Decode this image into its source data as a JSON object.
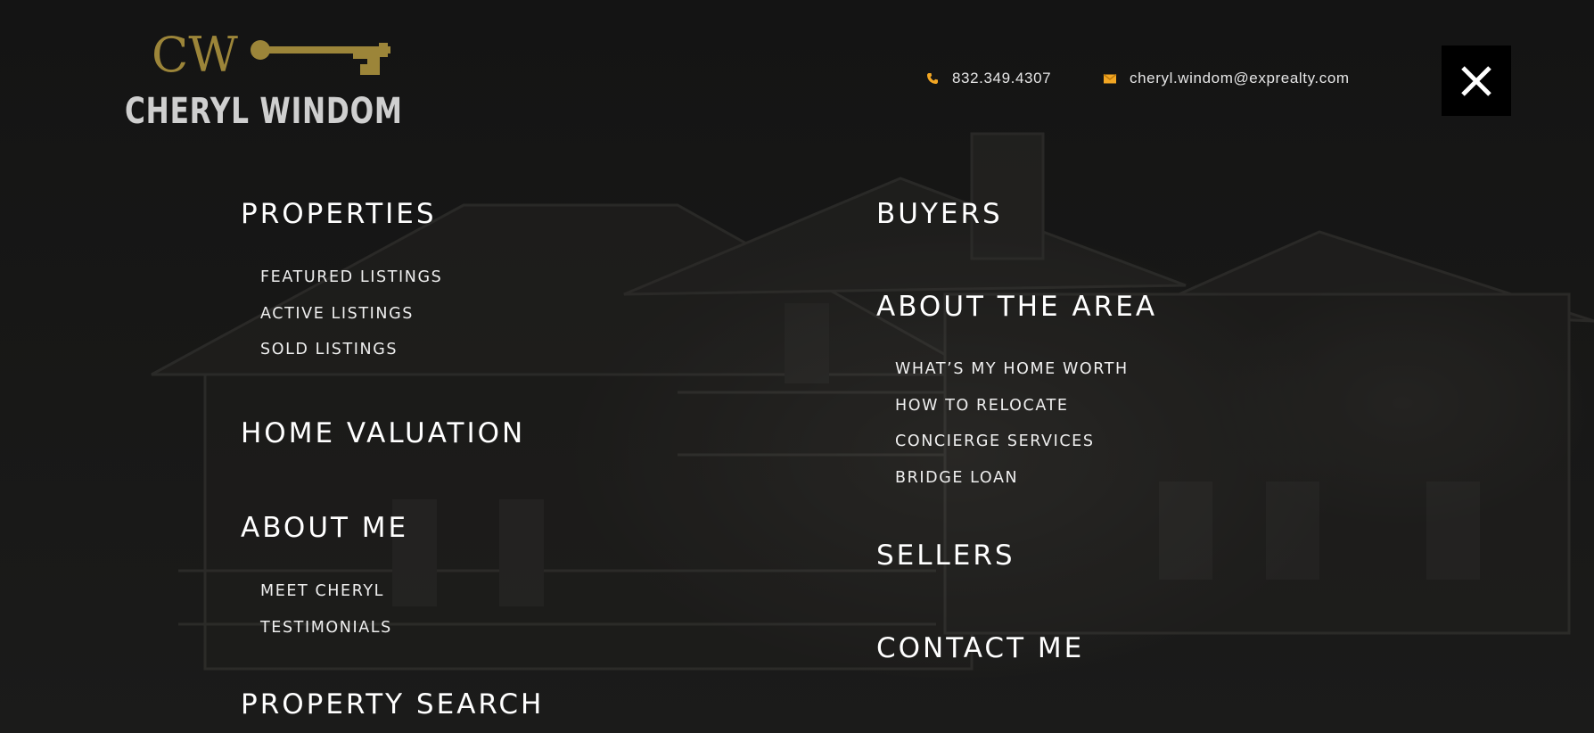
{
  "logo": {
    "monogram": "CW",
    "name": "CHERYL WINDOM",
    "gold_color": "#9c8539"
  },
  "contact": {
    "phone": "832.349.4307",
    "email": "cheryl.windom@exprealty.com",
    "phone_icon": "phone-icon",
    "email_icon": "envelope-icon",
    "icon_color": "#f2a623"
  },
  "close_button": {
    "icon": "close-icon",
    "background": "#000000"
  },
  "menu": {
    "left": [
      {
        "label": "PROPERTIES",
        "items": [
          "FEATURED LISTINGS",
          "ACTIVE LISTINGS",
          "SOLD LISTINGS"
        ]
      },
      {
        "label": "HOME VALUATION",
        "items": []
      },
      {
        "label": "ABOUT ME",
        "items": [
          "MEET CHERYL",
          "TESTIMONIALS"
        ]
      },
      {
        "label": "PROPERTY SEARCH",
        "items": []
      }
    ],
    "right": [
      {
        "label": "BUYERS",
        "items": []
      },
      {
        "label": "ABOUT THE AREA",
        "items": [
          "WHAT’S MY HOME WORTH",
          "HOW TO RELOCATE",
          "CONCIERGE SERVICES",
          "BRIDGE LOAN"
        ]
      },
      {
        "label": "SELLERS",
        "items": []
      },
      {
        "label": "CONTACT ME",
        "items": []
      }
    ]
  }
}
